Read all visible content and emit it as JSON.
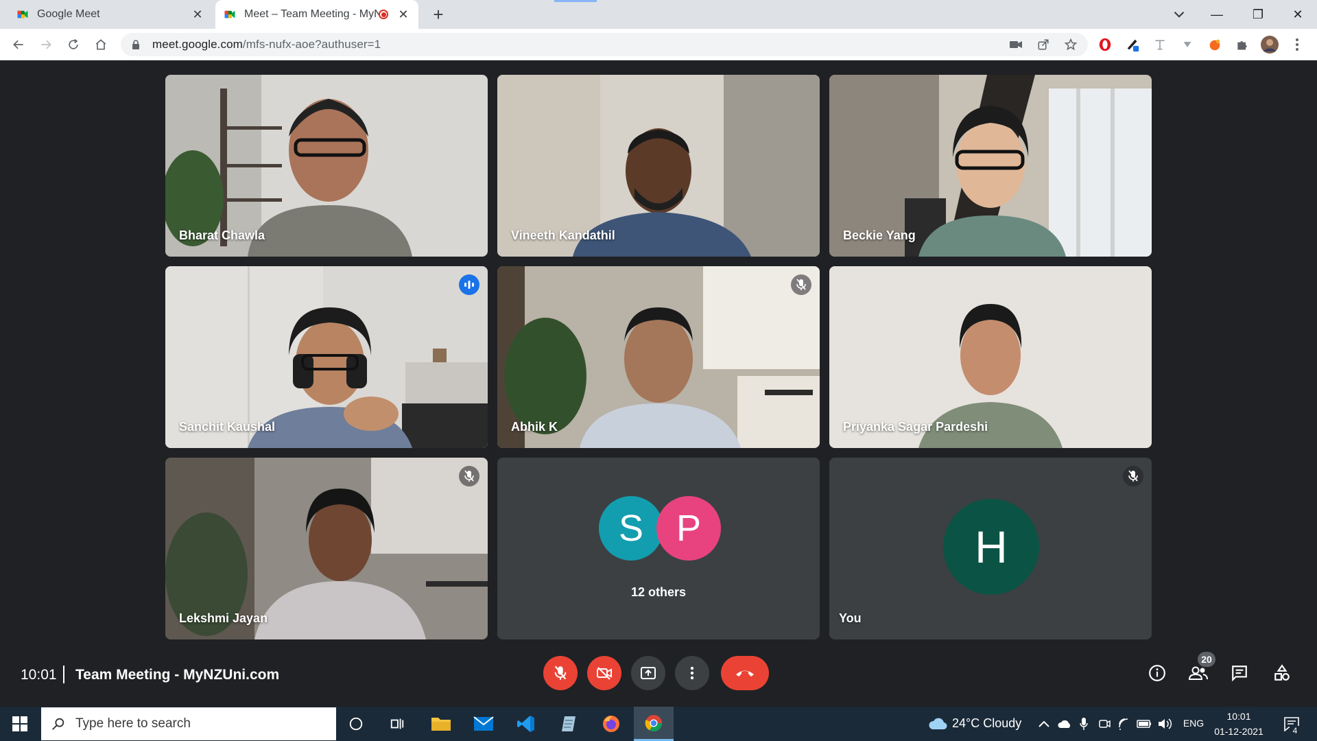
{
  "browser": {
    "tabs": [
      {
        "title": "Google Meet",
        "active": false
      },
      {
        "title": "Meet – Team Meeting - MyN",
        "active": true,
        "recording": true
      }
    ],
    "url_host": "meet.google.com",
    "url_path": "/mfs-nufx-aoe?authuser=1"
  },
  "meeting": {
    "participants": [
      {
        "name": "Bharat Chawla",
        "muted": false,
        "speaking": false
      },
      {
        "name": "Vineeth Kandathil",
        "muted": false,
        "speaking": false
      },
      {
        "name": "Beckie Yang",
        "muted": false,
        "speaking": false
      },
      {
        "name": "Sanchit Kaushal",
        "muted": false,
        "speaking": true
      },
      {
        "name": "Abhik K",
        "muted": true,
        "speaking": false
      },
      {
        "name": "Priyanka Sagar Pardeshi",
        "muted": false,
        "speaking": false
      },
      {
        "name": "Lekshmi Jayan",
        "muted": true,
        "speaking": false
      }
    ],
    "others": {
      "initials": [
        "S",
        "P"
      ],
      "label": "12 others"
    },
    "self": {
      "initial": "H",
      "label": "You",
      "muted": true
    },
    "time": "10:01",
    "title": "Team Meeting - MyNZUni.com",
    "participant_count": "20"
  },
  "colors": {
    "accent": "#8ab4f8",
    "meet_bg": "#202124",
    "end_call": "#ea4335",
    "avatar_s": "#129eaf",
    "avatar_p": "#e8437f",
    "avatar_h": "#0b5345"
  },
  "taskbar": {
    "search_placeholder": "Type here to search",
    "weather": "24°C  Cloudy",
    "language": "ENG",
    "time": "10:01",
    "date": "01-12-2021",
    "notifications": "4"
  }
}
